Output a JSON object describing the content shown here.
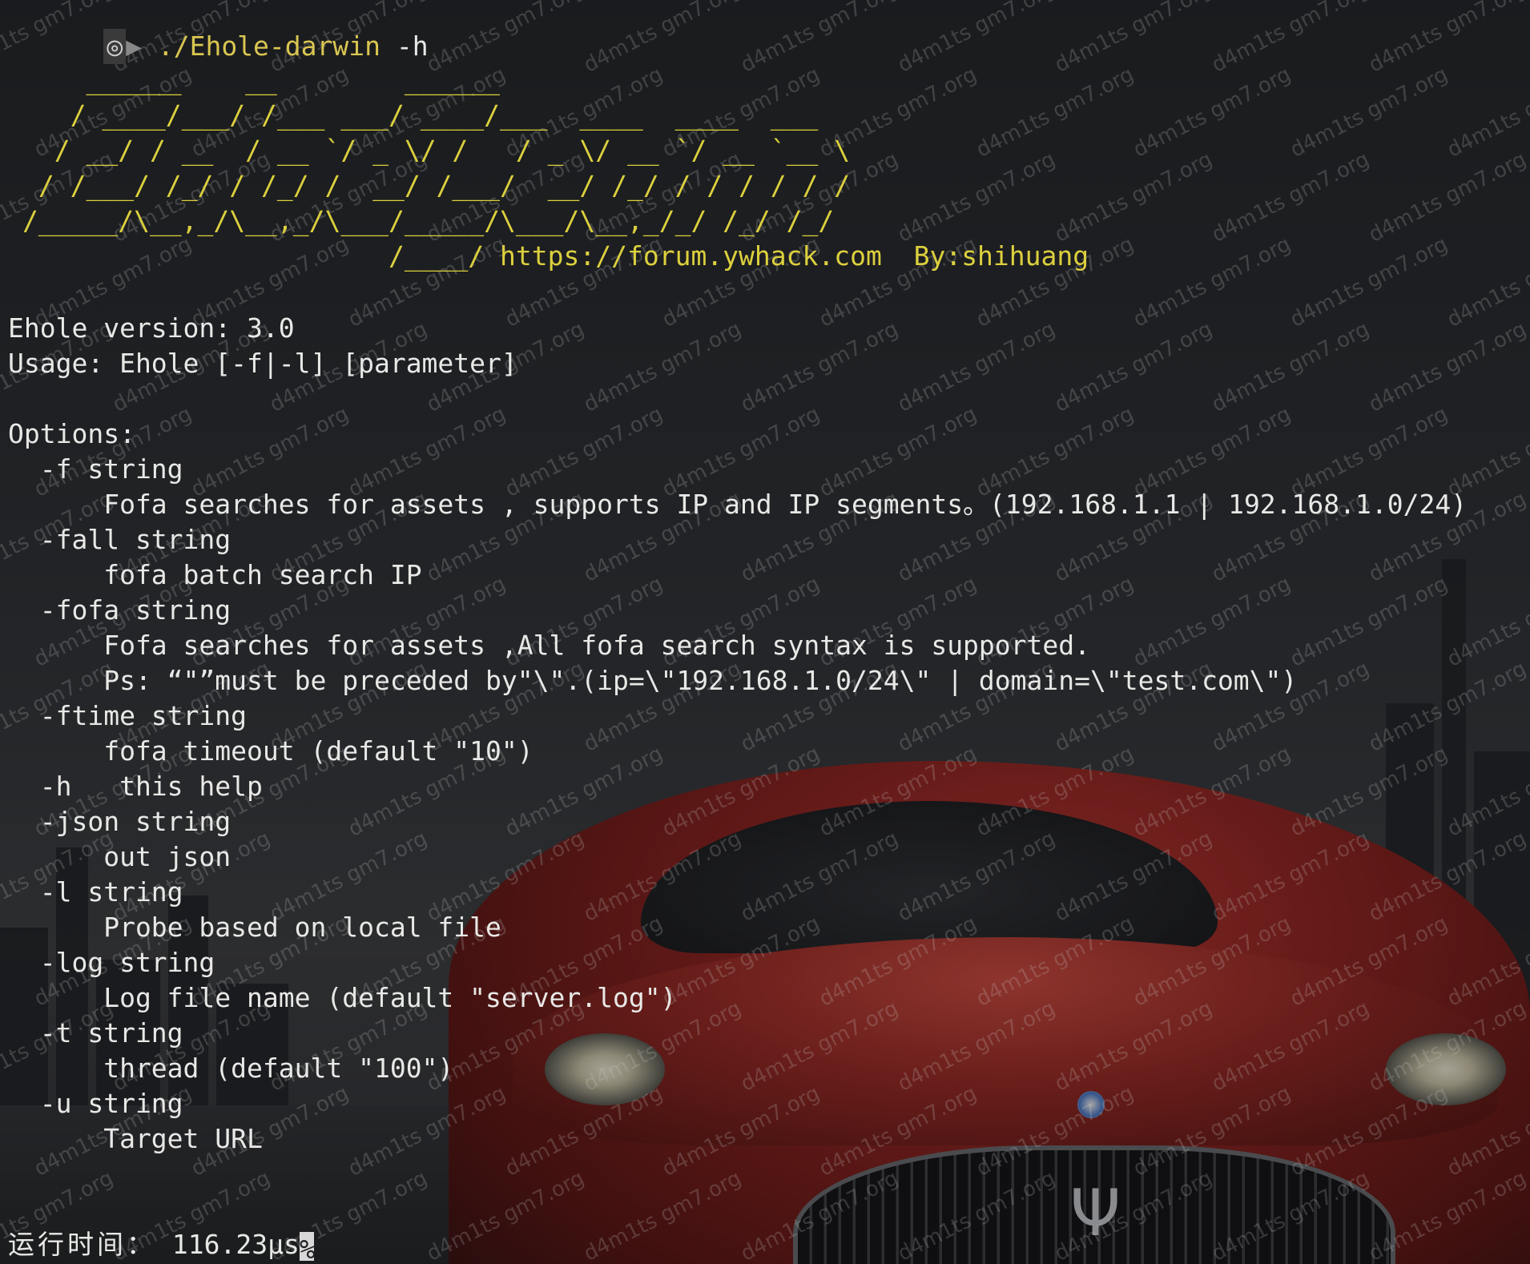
{
  "prompt": {
    "icon": "apple-logo-icon",
    "command": "./Ehole-darwin",
    "args": " -h"
  },
  "banner": {
    "art_lines": [
      "    ______    __        ______",
      "   / ____/___/ /___ ___/ ____/___  ____  ____  ___",
      "  / __/ / __  / __ `/ _ \\/ /   / _ \\/ __ `/ __ `__ \\",
      " / /___/ /_/ / /_/ /  __/ /___/  __/ /_/ / / / / / /",
      "/_____/\\__,_/\\__,_/\\___/_____/\\___/\\__,_/_/ /_/ /_/"
    ],
    "signature": "                       /____/ https://forum.ywhack.com  By:shihuang"
  },
  "info": {
    "version": "Ehole version: 3.0",
    "usage": "Usage: Ehole [-f|-l] [parameter]"
  },
  "options_header": "Options:",
  "options": [
    {
      "flag": "  -f string",
      "desc": [
        "      Fofa searches for assets , supports IP and IP segments。(192.168.1.1 | 192.168.1.0/24)"
      ]
    },
    {
      "flag": "  -fall string",
      "desc": [
        "      fofa batch search IP"
      ]
    },
    {
      "flag": "  -fofa string",
      "desc": [
        "      Fofa searches for assets ,All fofa search syntax is supported.",
        "      Ps: “\"”must be preceded by\"\\\".(ip=\\\"192.168.1.0/24\\\" | domain=\\\"test.com\\\")"
      ]
    },
    {
      "flag": "  -ftime string",
      "desc": [
        "      fofa timeout (default \"10\")"
      ]
    },
    {
      "flag": "  -h   this help",
      "desc": []
    },
    {
      "flag": "  -json string",
      "desc": [
        "      out json"
      ]
    },
    {
      "flag": "  -l string",
      "desc": [
        "      Probe based on local file"
      ]
    },
    {
      "flag": "  -log string",
      "desc": [
        "      Log file name (default \"server.log\")"
      ]
    },
    {
      "flag": "  -t string",
      "desc": [
        "      thread (default \"100\")"
      ]
    },
    {
      "flag": "  -u string",
      "desc": [
        "      Target URL"
      ]
    }
  ],
  "footer": {
    "runtime_label": "运行时间：",
    "runtime_value": " 116.23μs",
    "end_marker": "%"
  },
  "watermark": "d4m1ts gm7.org",
  "colors": {
    "banner": "#dcd03e",
    "text": "#e8e8e6",
    "command": "#d9c651",
    "car_red": "#c4322a"
  }
}
